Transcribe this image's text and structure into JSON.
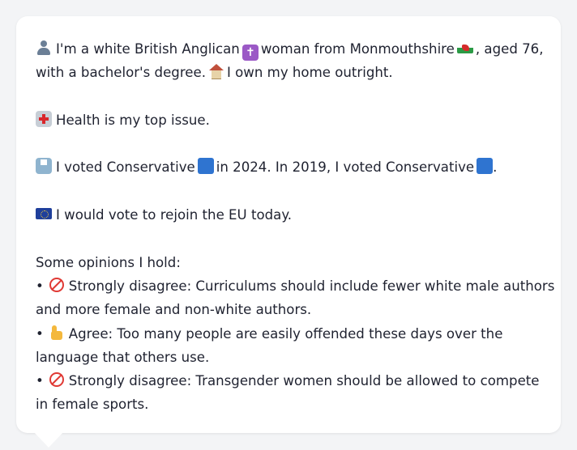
{
  "profile": {
    "intro_line1_a": "I'm a white British Anglican",
    "intro_line1_b": "woman from Monmouthshire",
    "intro_line1_c": ", aged 76,",
    "intro_line2_a": "with a bachelor's degree.",
    "intro_line2_b": "I own my home outright.",
    "health": "Health is my top issue.",
    "vote_a": "I voted Conservative",
    "vote_b": "in 2024. In 2019, I voted Conservative",
    "vote_c": ".",
    "eu": "I would vote to rejoin the EU today.",
    "opinions_heading": "Some opinions I hold:",
    "bullet_char": "•",
    "opinions": [
      {
        "line1": "Strongly disagree: Curriculums should include fewer white male authors",
        "line2": "and more female and non-white authors."
      },
      {
        "line1": "Agree: Too many people are easily offended these days over the",
        "line2": "language that others use."
      },
      {
        "line1": "Strongly disagree: Transgender women should be allowed to compete",
        "line2": "in female sports."
      }
    ]
  },
  "icons": {
    "person": "person-silhouette-icon",
    "religion": "latin-cross-icon",
    "region": "wales-flag-icon",
    "home": "house-icon",
    "health": "hospital-icon",
    "vote": "ballot-box-icon",
    "party": "blue-square-icon",
    "eu": "eu-flag-icon",
    "strongly_disagree": "no-entry-icon",
    "agree": "thumbs-up-icon"
  },
  "colors": {
    "background": "#f3f4f6",
    "card": "#ffffff",
    "text": "#1f2230",
    "party_blue": "#2f74d0"
  }
}
